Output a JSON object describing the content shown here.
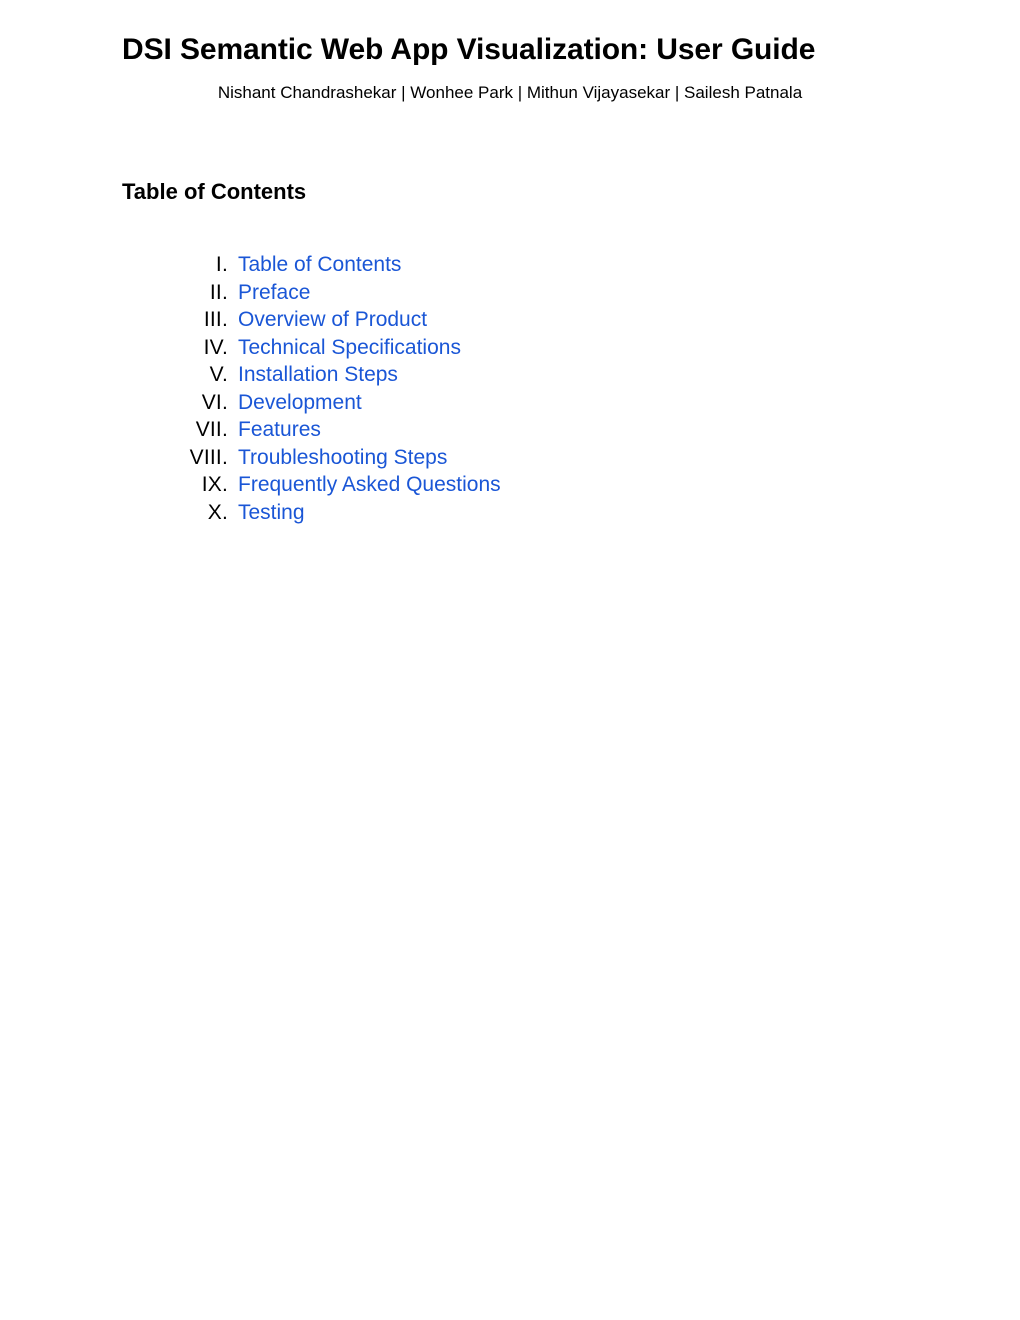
{
  "document": {
    "title": "DSI Semantic Web App Visualization: User Guide",
    "authors": "Nishant Chandrashekar | Wonhee Park | Mithun Vijayasekar | Sailesh Patnala"
  },
  "table_of_contents": {
    "heading": "Table of Contents",
    "link_color": "#1a56d6",
    "text_color": "#000000",
    "items": [
      {
        "numeral": "I.",
        "label": "Table of Contents"
      },
      {
        "numeral": "II.",
        "label": "Preface"
      },
      {
        "numeral": "III.",
        "label": "Overview of Product"
      },
      {
        "numeral": "IV.",
        "label": "Technical Specifications"
      },
      {
        "numeral": "V.",
        "label": "Installation Steps"
      },
      {
        "numeral": "VI.",
        "label": "Development"
      },
      {
        "numeral": "VII.",
        "label": "Features"
      },
      {
        "numeral": "VIII.",
        "label": "Troubleshooting Steps"
      },
      {
        "numeral": "IX.",
        "label": "Frequently Asked Questions"
      },
      {
        "numeral": "X.",
        "label": "Testing"
      }
    ]
  }
}
